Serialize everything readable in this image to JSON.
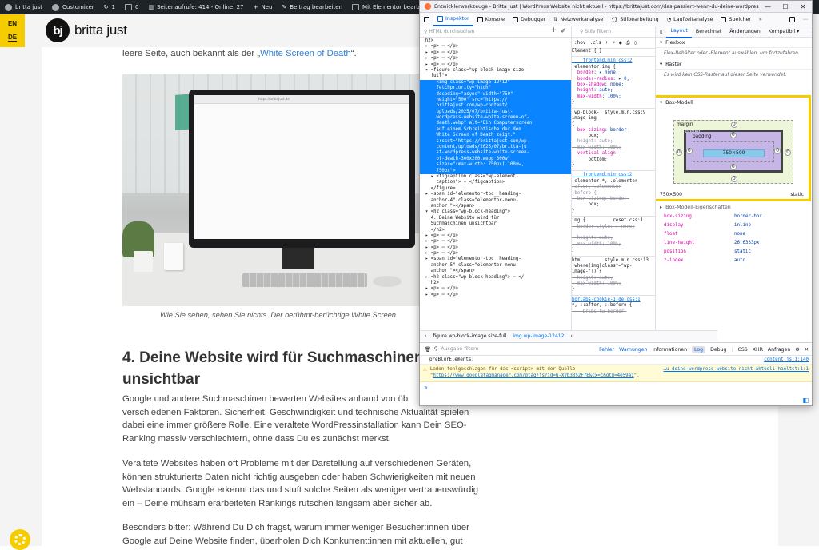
{
  "adminbar": {
    "site_name": "britta just",
    "customizer": "Customizer",
    "updates": "1",
    "comments": "0",
    "views": "Seitenaufrufe: 414 - Online: 27",
    "new": "Neu",
    "edit_post": "Beitrag bearbeiten",
    "elementor": "Mit Elementor bearbeiten"
  },
  "site": {
    "lang_en": "EN",
    "lang_de": "DE",
    "logo_mark": "bj",
    "logo_text": "britta just",
    "intro_text": "leere Seite, auch bekannt als der „",
    "intro_link": "White Screen of Death",
    "intro_end": "“.",
    "hero_browser_url": "https://brittajust.de",
    "caption": "Wie Sie sehen, sehen Sie nichts. Der berühmt-berüchtige White Screen",
    "h2_line1": "4. Deine Website wird für Suchmaschinen",
    "h2_line2": "unsichtbar",
    "p1": "Google und andere Suchmaschinen bewerten Websites anhand von üb",
    "p1b": "verschiedenen Faktoren. Sicherheit, Geschwindigkeit und technische Aktualität spielen",
    "p1c": "dabei eine immer größere Rolle. Eine veraltete WordPressinstallation kann Dein SEO-",
    "p1d": "Ranking massiv verschlechtern, ohne dass Du es zunächst merkst.",
    "p2a": "Veraltete Websites haben oft Probleme mit der Darstellung auf verschiedenen Geräten,",
    "p2b": "können strukturierte Daten nicht richtig ausgeben oder haben Schwierigkeiten mit neuen",
    "p2c": "Webstandards. Google erkennt das und stuft solche Seiten als weniger vertrauenswürdig",
    "p2d": "ein – Deine mühsam erarbeiteten Rankings rutschen langsam aber sicher ab.",
    "p3a": "Besonders bitter: Während Du Dich fragst, warum immer weniger Besucher:innen über",
    "p3b": "Google auf Deine Website finden, überholen Dich Konkurrent:innen mit aktuellen, gut"
  },
  "devtools": {
    "title": "Entwicklerwerkzeuge - Britta Just | WordPress Website nicht aktuell - https://brittajust.com/das-passiert-wenn-du-deine-wordpress-websit…",
    "tabs": [
      "Inspektor",
      "Konsole",
      "Debugger",
      "Netzwerkanalyse",
      "Stilbearbeitung",
      "Laufzeitanalyse",
      "Speicher"
    ],
    "search_placeholder": "HTML durchsuchen",
    "markup_lines": [
      "  h2>",
      "  ▸ <p> ⋯ </p>",
      "  ▸ <p> ⋯ </p>",
      "  ▸ <p> ⋯ </p>",
      "  ▸ <p> ⋯ </p>",
      "  ▾ <figure class=\"wp-block-image size-",
      "    full\">"
    ],
    "selected_lines": [
      "      <img class=\"wp-image-12412\"",
      "      fetchpriority=\"high\"",
      "      decoding=\"async\" width=\"750\"",
      "      height=\"500\" src=\"https://",
      "      brittajust.com/wp-content/",
      "      uploads/2025/07/britta-just-",
      "      wordpress-website-white-screen-of-",
      "      death.webp\" alt=\"Ein Computerscreen",
      "      auf einem Schreibtische der den",
      "      White Screen of Death zeigt.\"",
      "      srcset=\"https://brittajust.com/wp-",
      "      content/uploads/2025/07/britta-ju",
      "      st-wordpress-website-white-screen-",
      "      of-death-300x200.webp 300w\"",
      "      sizes=\"(max-width: 750px) 100vw,",
      "      750px\">"
    ],
    "markup_after": [
      "    ▸ <figcaption class=\"wp-element-",
      "      caption\"> ⋯ </figcaption>",
      "    </figure>",
      "  ▸ <span id=\"elementor-toc__heading-",
      "    anchor-4\" class=\"elementor-menu-",
      "    anchor \"></span>",
      "  ▾ <h2 class=\"wp-block-heading\">",
      "    4. Deine Website wird für",
      "    Suchmaschinen unsichtbar",
      "    </h2>",
      "  ▸ <p> ⋯ </p>",
      "  ▸ <p> ⋯ </p>",
      "  ▸ <p> ⋯ </p>",
      "  ▸ <p> ⋯ </p>",
      "  ▸ <span id=\"elementor-toc__heading-",
      "    anchor-5\" class=\"elementor-menu-",
      "    anchor \"></span>",
      "  ▸ <h2 class=\"wp-block-heading\"> ⋯ </",
      "    h2>",
      "  ▸ <p> ⋯ </p>",
      "  ▸ <p> ⋯ </p>"
    ],
    "crumb1": "figure.wp-block-image.size-full",
    "crumb2": "img.wp-image-12412",
    "rules_filter": "Stile filtern",
    "rules_opts": [
      ":hov",
      ".cls",
      "+"
    ],
    "rules": [
      {
        "t": "plain",
        "s": "Element { }"
      },
      {
        "t": "sep"
      },
      {
        "t": "src",
        "s": "    frontend.min.css:2"
      },
      {
        "t": "plain",
        "s": ".elementor img {"
      },
      {
        "t": "pv",
        "p": "  border",
        "v": ": ▸ none;"
      },
      {
        "t": "pv",
        "p": "  border-radius",
        "v": ": ▸ 0;"
      },
      {
        "t": "pv",
        "p": "  box-shadow",
        "v": ": none;"
      },
      {
        "t": "pv",
        "p": "  height",
        "v": ": auto;"
      },
      {
        "t": "pv",
        "p": "  max-width",
        "v": ": 100%;"
      },
      {
        "t": "plain",
        "s": "}"
      },
      {
        "t": "sep"
      },
      {
        "t": "plain",
        "s": ".wp-block-  style.min.css:9"
      },
      {
        "t": "plain",
        "s": "image img"
      },
      {
        "t": "plain",
        "s": "{"
      },
      {
        "t": "pv",
        "p": "  box-sizing",
        "v": ": border-"
      },
      {
        "t": "plain",
        "s": "      box;"
      },
      {
        "t": "strike",
        "s": "  height: auto;"
      },
      {
        "t": "strike",
        "s": "  max-width: 100%;"
      },
      {
        "t": "pv",
        "p": "  vertical-align",
        "v": ":"
      },
      {
        "t": "plain",
        "s": "      bottom;"
      },
      {
        "t": "plain",
        "s": "}"
      },
      {
        "t": "sep"
      },
      {
        "t": "src",
        "s": "    frontend.min.css:2"
      },
      {
        "t": "plain",
        "s": ".elementor *, .elementor"
      },
      {
        "t": "strike",
        "s": ":after, .elementor"
      },
      {
        "t": "strike",
        "s": ":before {"
      },
      {
        "t": "strike",
        "s": "  box-sizing: border-"
      },
      {
        "t": "plain",
        "s": "      box;"
      },
      {
        "t": "plain",
        "s": "}"
      },
      {
        "t": "sep"
      },
      {
        "t": "plain",
        "s": "img {          reset.css:1"
      },
      {
        "t": "strike",
        "s": "  border-style: ▸ none;"
      },
      {
        "t": "plain",
        "s": "      "
      },
      {
        "t": "strike",
        "s": "  height: auto;"
      },
      {
        "t": "strike",
        "s": "  max-width: 100%;"
      },
      {
        "t": "plain",
        "s": "}"
      },
      {
        "t": "sep"
      },
      {
        "t": "plain",
        "s": "html        style.min.css:13"
      },
      {
        "t": "plain",
        "s": ":where(img[class*=\"wp-"
      },
      {
        "t": "plain",
        "s": "image-\"]) {"
      },
      {
        "t": "strike",
        "s": "  height: auto;"
      },
      {
        "t": "strike",
        "s": "  max-width: 100%;"
      },
      {
        "t": "plain",
        "s": "}"
      },
      {
        "t": "sep"
      },
      {
        "t": "src",
        "s": "borlabs-cookie-1-de.css:1"
      },
      {
        "t": "plain",
        "s": "*, ::after, ::before {"
      },
      {
        "t": "strike",
        "s": "  --brlbs-tw-border-"
      }
    ],
    "layout_tabs": [
      "Layout",
      "Berechnet",
      "Änderungen",
      "Kompatibil ▾"
    ],
    "flexbox_title": "Flexbox",
    "flexbox_note": "Flex-Behälter oder -Element auswählen, um fortzufahren.",
    "grid_title": "Raster",
    "grid_note": "Es wird kein CSS-Raster auf dieser Seite verwendet.",
    "boxmodel_title": "Box-Modell",
    "bm_margin": "margin",
    "bm_border": "border",
    "bm_padding": "padding",
    "bm_content": "750×500",
    "bm_zero": "0",
    "box_size": "750×500",
    "box_position": "static",
    "props_title": "Box-Modell-Eigenschaften",
    "props": [
      {
        "k": "box-sizing",
        "v": "border-box"
      },
      {
        "k": "display",
        "v": "inline"
      },
      {
        "k": "float",
        "v": "none"
      },
      {
        "k": "line-height",
        "v": "26.6333px"
      },
      {
        "k": "position",
        "v": "static"
      },
      {
        "k": "z-index",
        "v": "auto"
      }
    ],
    "console_filter": "Ausgabe filtern",
    "console_levels": [
      "Fehler",
      "Warnungen",
      "Informationen",
      "Log",
      "Debug",
      "CSS",
      "XHR",
      "Anfragen"
    ],
    "log_line": "preBlurElements:",
    "log_loc": "content.js:1:140",
    "warn_text1": "Laden fehlgeschlagen für das <script> mit der Quelle \"",
    "warn_link": "https://www.googletagmanager.com/gtag/js?id=G-XVb3352F7E&cx=c&gtm=4e59a1",
    "warn_text2": "\".",
    "warn_loc": "…u-deine-wordpress-website-nicht-aktuell-haeltst:1:1",
    "prompt": "»"
  }
}
